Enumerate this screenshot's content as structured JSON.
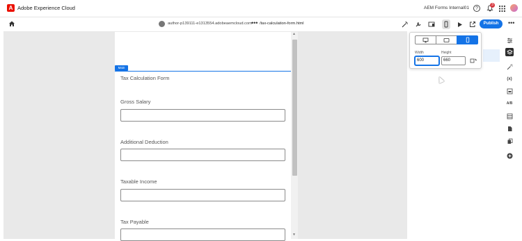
{
  "topbar": {
    "logo_letter": "A",
    "app_title": "Adobe Experience Cloud",
    "org_name": "AEM Forms Internal01",
    "help_icon": "?",
    "notification_count": "3",
    "icons": [
      "help-icon",
      "bell-icon",
      "apps-grid-icon",
      "user-avatar"
    ]
  },
  "toolbar": {
    "url_host": "author-p139111-e1313554.adobeaemcloud.com",
    "url_more": "•••",
    "url_path": "/tax-calculation-form.html",
    "publish_label": "Publish",
    "more_label": "•••",
    "tools": [
      "magic-wand-icon",
      "wrench-icon",
      "device-layout-icon",
      "mobile-preview-icon",
      "play-icon",
      "open-external-icon"
    ]
  },
  "form": {
    "container_tag": "Main",
    "title": "Tax Calculation Form",
    "fields": [
      {
        "label": "Gross Salary",
        "value": ""
      },
      {
        "label": "Additional Deduction",
        "value": ""
      },
      {
        "label": "Taxable Income",
        "value": ""
      },
      {
        "label": "Tax Payable",
        "value": ""
      }
    ]
  },
  "device_popover": {
    "devices": [
      "desktop",
      "tablet",
      "phone"
    ],
    "selected_device": "phone",
    "width_label": "Width",
    "width_value": "600",
    "height_label": "Height",
    "height_value": "660"
  },
  "right_rail": {
    "icons": [
      "properties-icon",
      "layers-icon",
      "wand-icon",
      "variables-icon",
      "form-icon",
      "ab-test-icon",
      "table-icon",
      "document-icon",
      "copy-icon",
      "add-icon"
    ],
    "ab_label": "A/B",
    "variables_label": "(x)"
  },
  "colors": {
    "accent": "#1473e6",
    "adobe_red": "#eb1000",
    "badge_red": "#d7373f",
    "canvas_bg": "#e9e9e9"
  }
}
